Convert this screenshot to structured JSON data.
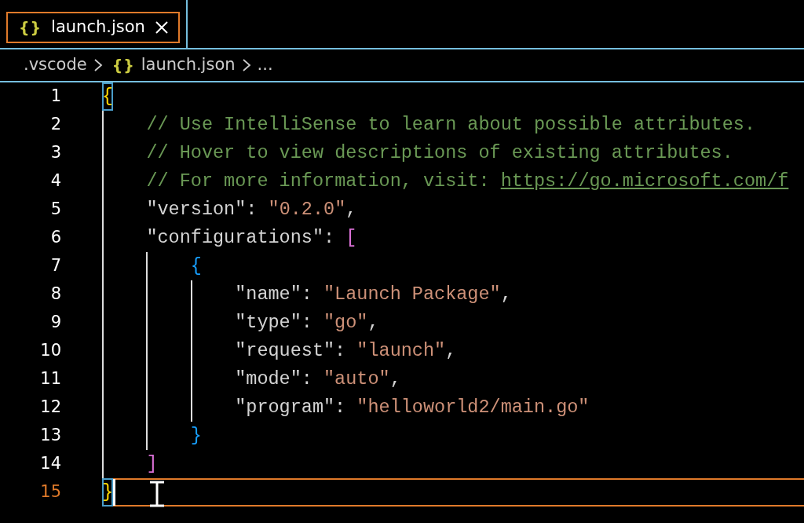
{
  "tabs": [
    {
      "icon": "{}",
      "label": "launch.json",
      "selected": true
    }
  ],
  "breadcrumb": [
    {
      "label": ".vscode"
    },
    {
      "icon": "{}",
      "label": "launch.json"
    },
    {
      "label": "..."
    }
  ],
  "editor": {
    "lines": [
      {
        "number": "1",
        "current": false,
        "tokens": [
          {
            "kind": "bracket",
            "text": "{",
            "color": "#ffd700",
            "matched": true
          }
        ],
        "children": [
          {
            "number": "2",
            "current": false,
            "tokens": [
              {
                "kind": "comment",
                "text": "// Use IntelliSense to learn about possible attributes."
              }
            ]
          },
          {
            "number": "3",
            "current": false,
            "tokens": [
              {
                "kind": "comment",
                "text": "// Hover to view descriptions of existing attributes."
              }
            ]
          },
          {
            "number": "4",
            "current": false,
            "tokens": [
              {
                "kind": "comment",
                "text": "// For more information, visit: "
              },
              {
                "kind": "link",
                "text": "https://go.microsoft.com/f"
              }
            ]
          },
          {
            "number": "5",
            "current": false,
            "tokens": [
              {
                "kind": "key",
                "text": "\"version\": "
              },
              {
                "kind": "string",
                "text": "\"0.2.0\""
              },
              {
                "kind": "punct",
                "text": ","
              }
            ]
          },
          {
            "number": "6",
            "current": false,
            "tokens": [
              {
                "kind": "key",
                "text": "\"configurations\": "
              },
              {
                "kind": "bracket",
                "text": "[",
                "color": "#da70d6",
                "matched": false
              }
            ],
            "children": [
              {
                "number": "7",
                "current": false,
                "tokens": [
                  {
                    "kind": "bracket",
                    "text": "{",
                    "color": "#179fff",
                    "matched": false
                  }
                ],
                "children": [
                  {
                    "number": "8",
                    "current": false,
                    "tokens": [
                      {
                        "kind": "key",
                        "text": "\"name\": "
                      },
                      {
                        "kind": "string",
                        "text": "\"Launch Package\""
                      },
                      {
                        "kind": "punct",
                        "text": ","
                      }
                    ]
                  },
                  {
                    "number": "9",
                    "current": false,
                    "tokens": [
                      {
                        "kind": "key",
                        "text": "\"type\": "
                      },
                      {
                        "kind": "string",
                        "text": "\"go\""
                      },
                      {
                        "kind": "punct",
                        "text": ","
                      }
                    ]
                  },
                  {
                    "number": "10",
                    "current": false,
                    "tokens": [
                      {
                        "kind": "key",
                        "text": "\"request\": "
                      },
                      {
                        "kind": "string",
                        "text": "\"launch\""
                      },
                      {
                        "kind": "punct",
                        "text": ","
                      }
                    ]
                  },
                  {
                    "number": "11",
                    "current": false,
                    "tokens": [
                      {
                        "kind": "key",
                        "text": "\"mode\": "
                      },
                      {
                        "kind": "string",
                        "text": "\"auto\""
                      },
                      {
                        "kind": "punct",
                        "text": ","
                      }
                    ]
                  },
                  {
                    "number": "12",
                    "current": false,
                    "tokens": [
                      {
                        "kind": "key",
                        "text": "\"program\": "
                      },
                      {
                        "kind": "string",
                        "text": "\"helloworld2/main.go\""
                      }
                    ]
                  }
                ]
              },
              {
                "number": "13",
                "current": false,
                "tokens": [
                  {
                    "kind": "bracket",
                    "text": "}",
                    "color": "#179fff",
                    "matched": false
                  }
                ]
              }
            ]
          },
          {
            "number": "14",
            "current": false,
            "tokens": [
              {
                "kind": "bracket",
                "text": "]",
                "color": "#da70d6",
                "matched": false
              }
            ]
          }
        ]
      },
      {
        "number": "15",
        "current": true,
        "tokens": [
          {
            "kind": "bracket",
            "text": "}",
            "color": "#ffd700",
            "matched": true
          }
        ]
      }
    ]
  }
}
